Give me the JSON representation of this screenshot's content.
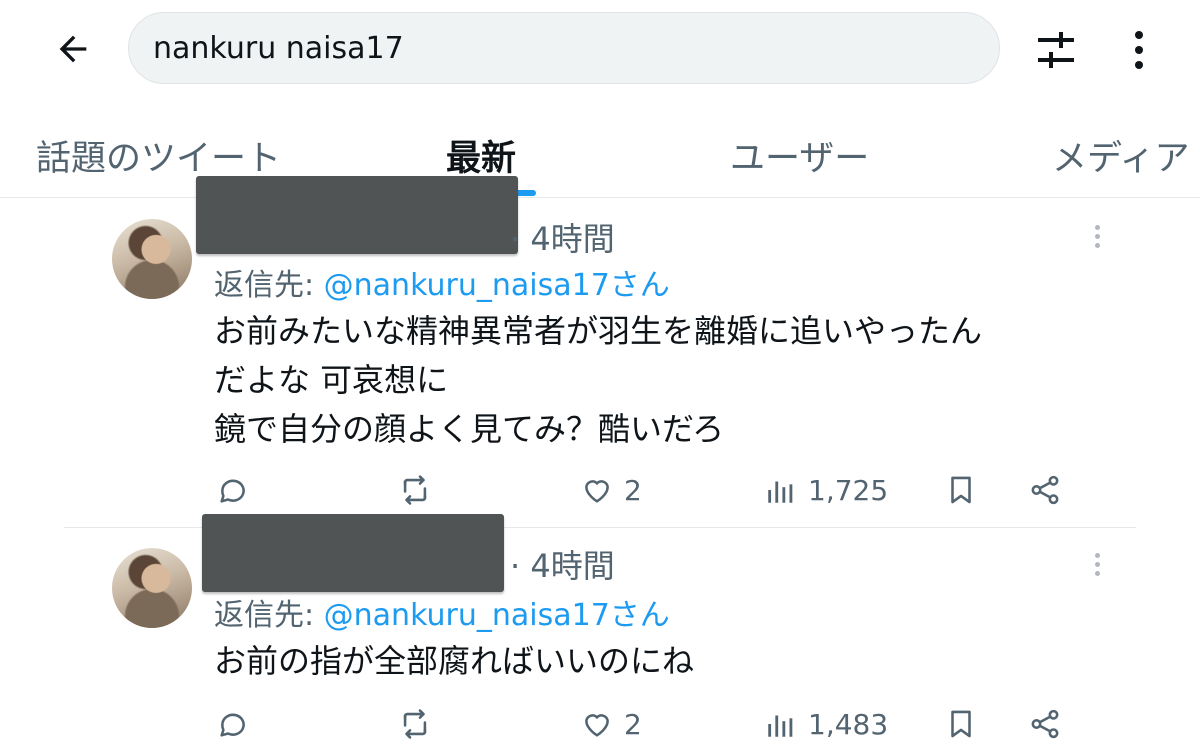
{
  "search": {
    "query": "nankuru naisa17"
  },
  "tabs": [
    {
      "label": "話題のツイート"
    },
    {
      "label": "最新"
    },
    {
      "label": "ユーザー"
    },
    {
      "label": "メディア"
    }
  ],
  "active_tab": "最新",
  "tweets": [
    {
      "time": "· 4時間",
      "reply_prefix": "返信先: ",
      "reply_handle": "@nankuru_naisa17さん",
      "text": "お前みたいな精神異常者が羽生を離婚に追いやったん\nだよな 可哀想に\n鏡で自分の顔よく見てみ？酷いだろ",
      "likes": "2",
      "views": "1,725"
    },
    {
      "time": "· 4時間",
      "reply_prefix": "返信先: ",
      "reply_handle": "@nankuru_naisa17さん",
      "text": "お前の指が全部腐ればいいのにね",
      "likes": "2",
      "views": "1,483"
    }
  ],
  "icons": {
    "back": "arrow-left-icon",
    "filter": "sliders-icon",
    "more": "more-vertical-icon",
    "reply": "comment-icon",
    "retweet": "retweet-icon",
    "like": "heart-icon",
    "views": "bar-chart-icon",
    "bookmark": "bookmark-icon",
    "share": "share-icon"
  },
  "colors": {
    "accent": "#1d9bf0",
    "text": "#0f1419",
    "muted": "#536471",
    "redaction": "#505455"
  }
}
